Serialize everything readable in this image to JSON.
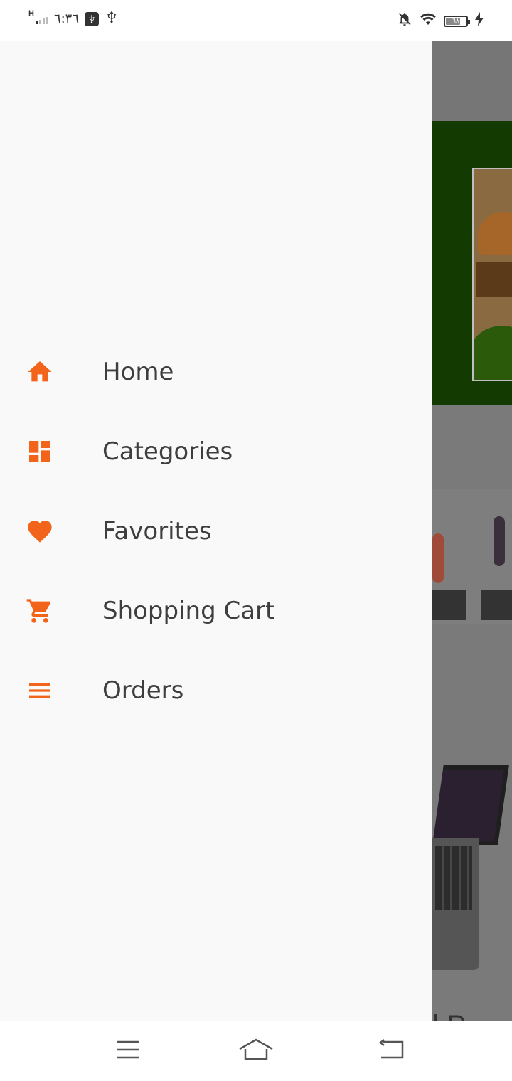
{
  "status_bar": {
    "network": "H",
    "time": "٦:٣٦",
    "battery_level": "٦٨",
    "icons": [
      "signal-icon",
      "usb-debug-icon",
      "usb-icon",
      "notifications-off-icon",
      "wifi-icon",
      "battery-icon",
      "charging-icon"
    ]
  },
  "drawer": {
    "accent_color": "#f26419",
    "items": [
      {
        "label": "Home",
        "icon": "home-icon"
      },
      {
        "label": "Categories",
        "icon": "dashboard-icon"
      },
      {
        "label": "Favorites",
        "icon": "heart-icon"
      },
      {
        "label": "Shopping Cart",
        "icon": "cart-icon"
      },
      {
        "label": "Orders",
        "icon": "list-icon"
      }
    ]
  },
  "background_app": {
    "partial_text": "l P"
  },
  "nav_bar": {
    "buttons": [
      "menu-icon",
      "home-icon",
      "back-icon"
    ]
  }
}
